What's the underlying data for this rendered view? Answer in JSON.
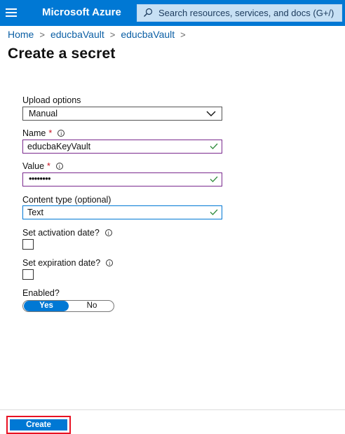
{
  "header": {
    "brand": "Microsoft Azure",
    "search_placeholder": "Search resources, services, and docs (G+/)",
    "accent_color": "#0078d4"
  },
  "breadcrumb": {
    "items": [
      "Home",
      "educbaVault",
      "educbaVault"
    ],
    "separator": ">"
  },
  "page": {
    "title": "Create a secret"
  },
  "form": {
    "upload_options": {
      "label": "Upload options",
      "value": "Manual"
    },
    "name": {
      "label": "Name",
      "required_mark": "*",
      "value": "educbaKeyVault"
    },
    "value": {
      "label": "Value",
      "required_mark": "*",
      "value": "••••••••"
    },
    "content_type": {
      "label": "Content type (optional)",
      "value": "Text"
    },
    "activation": {
      "label": "Set activation date?"
    },
    "expiration": {
      "label": "Set expiration date?"
    },
    "enabled": {
      "label": "Enabled?",
      "yes": "Yes",
      "no": "No",
      "selected": "Yes"
    }
  },
  "footer": {
    "create_label": "Create"
  },
  "icons": {
    "menu": "hamburger-icon",
    "search": "search-icon",
    "info": "info-icon",
    "check": "checkmark-icon",
    "dropdown": "chevron-down-icon"
  }
}
